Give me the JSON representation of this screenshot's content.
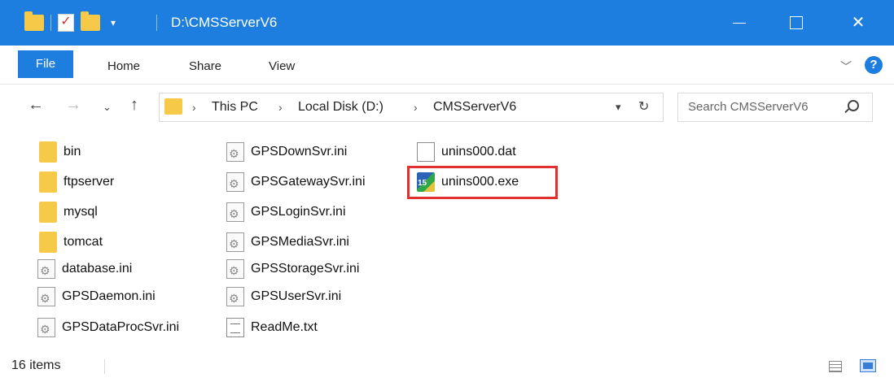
{
  "window": {
    "title": "D:\\CMSServerV6"
  },
  "ribbon": {
    "tabs": [
      "File",
      "Home",
      "Share",
      "View"
    ]
  },
  "address": {
    "crumbs": [
      "This PC",
      "Local Disk (D:)",
      "CMSServerV6"
    ],
    "search_placeholder": "Search CMSServerV6"
  },
  "files": [
    {
      "name": "bin",
      "type": "folder-icon"
    },
    {
      "name": "ftpserver",
      "type": "folder-icon"
    },
    {
      "name": "mysql",
      "type": "folder-icon"
    },
    {
      "name": "tomcat",
      "type": "folder-icon"
    },
    {
      "name": "database.ini",
      "type": "ini-file-icon"
    },
    {
      "name": "GPSDaemon.ini",
      "type": "ini-file-icon"
    },
    {
      "name": "GPSDataProcSvr.ini",
      "type": "ini-file-icon"
    },
    {
      "name": "GPSDownSvr.ini",
      "type": "ini-file-icon"
    },
    {
      "name": "GPSGatewaySvr.ini",
      "type": "ini-file-icon"
    },
    {
      "name": "GPSLoginSvr.ini",
      "type": "ini-file-icon"
    },
    {
      "name": "GPSMediaSvr.ini",
      "type": "ini-file-icon"
    },
    {
      "name": "GPSStorageSvr.ini",
      "type": "ini-file-icon"
    },
    {
      "name": "GPSUserSvr.ini",
      "type": "ini-file-icon"
    },
    {
      "name": "ReadMe.txt",
      "type": "text-file-icon"
    },
    {
      "name": "unins000.dat",
      "type": "dat-file-icon"
    },
    {
      "name": "unins000.exe",
      "type": "exe-file-icon"
    }
  ],
  "status": {
    "item_count": "16 items"
  },
  "colors": {
    "accent": "#1d7ee0",
    "highlight": "#e03030",
    "folder": "#f7c948"
  }
}
